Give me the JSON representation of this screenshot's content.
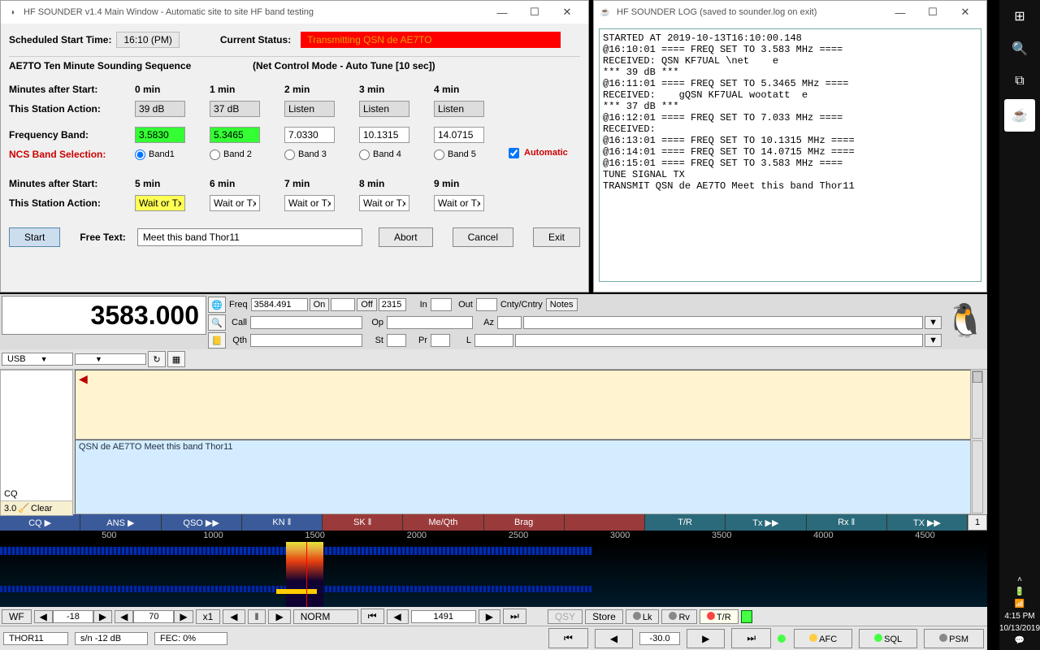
{
  "main_win": {
    "title": "HF SOUNDER v1.4 Main Window - Automatic site to site HF band testing",
    "sched_label": "Scheduled Start Time:",
    "sched_value": "16:10 (PM)",
    "status_label": "Current Status:",
    "status_value": "Transmitting QSN de AE7TO",
    "seq_title": "AE7TO  Ten Minute Sounding Sequence",
    "mode_title": "(Net Control Mode - Auto Tune [10 sec])",
    "row_labels": {
      "mins": "Minutes after Start:",
      "action": "This Station Action:",
      "freq": "Frequency Band:",
      "ncs": "NCS Band Selection:"
    },
    "cols1": [
      {
        "min": "0 min",
        "action": "39 dB",
        "action_cls": "ro",
        "freq": "3.5830",
        "freq_cls": "green",
        "band": "Band1",
        "checked": true
      },
      {
        "min": "1 min",
        "action": "37 dB",
        "action_cls": "ro",
        "freq": "5.3465",
        "freq_cls": "green",
        "band": "Band 2"
      },
      {
        "min": "2 min",
        "action": "Listen",
        "action_cls": "ro",
        "freq": "7.0330",
        "freq_cls": "",
        "band": "Band 3"
      },
      {
        "min": "3 min",
        "action": "Listen",
        "action_cls": "ro",
        "freq": "10.1315",
        "freq_cls": "",
        "band": "Band 4"
      },
      {
        "min": "4 min",
        "action": "Listen",
        "action_cls": "ro",
        "freq": "14.0715",
        "freq_cls": "",
        "band": "Band 5"
      }
    ],
    "auto_label": "Automatic",
    "cols2": [
      {
        "min": "5 min",
        "action": "Wait or Tx",
        "cls": "yellow"
      },
      {
        "min": "6 min",
        "action": "Wait or Tx"
      },
      {
        "min": "7 min",
        "action": "Wait or Tx"
      },
      {
        "min": "8 min",
        "action": "Wait or Tx"
      },
      {
        "min": "9 min",
        "action": "Wait or Tx"
      }
    ],
    "buttons": {
      "start": "Start",
      "abort": "Abort",
      "cancel": "Cancel",
      "exit": "Exit",
      "freetext_label": "Free Text:",
      "freetext_value": "Meet this band Thor11"
    }
  },
  "log_win": {
    "title": "HF SOUNDER LOG (saved to sounder.log on exit)",
    "text": "STARTED AT 2019-10-13T16:10:00.148\n@16:10:01 ==== FREQ SET TO 3.583 MHz ====\nRECEIVED: QSN KF7UAL \\net    e\n*** 39 dB ***\n@16:11:01 ==== FREQ SET TO 5.3465 MHz ====\nRECEIVED:    gQSN KF7UAL wootatt  e\n*** 37 dB ***\n@16:12:01 ==== FREQ SET TO 7.033 MHz ====\nRECEIVED:\n@16:13:01 ==== FREQ SET TO 10.1315 MHz ====\n@16:14:01 ==== FREQ SET TO 14.0715 MHz ====\n@16:15:01 ==== FREQ SET TO 3.583 MHz ====\nTUNE SIGNAL TX\nTRANSMIT QSN de AE7TO Meet this band Thor11"
  },
  "fldigi": {
    "bigfreq": "3583.000",
    "freq_label": "Freq",
    "freq_val": "3584.491",
    "on": "On",
    "off": "Off",
    "off_val": "2315",
    "in": "In",
    "out": "Out",
    "cc": "Cnty/Cntry",
    "notes": "Notes",
    "call": "Call",
    "op": "Op",
    "az": "Az",
    "qth": "Qth",
    "st": "St",
    "pr": "Pr",
    "l": "L",
    "mode": "USB",
    "tx_msg": "QSN de AE7TO Meet this band Thor11",
    "cq": "CQ",
    "clear": "Clear",
    "clear_num": "3.0",
    "macros": [
      "CQ ▶",
      "ANS ▶",
      "QSO ▶▶",
      "KN ‖",
      "SK ‖",
      "Me/Qth",
      "Brag",
      "",
      "T/R",
      "Tx ▶▶",
      "Rx ‖",
      "TX ▶▶"
    ],
    "macro_num": "1",
    "ruler": [
      "500",
      "1000",
      "1500",
      "2000",
      "2500",
      "3000",
      "3500",
      "4000",
      "4500"
    ],
    "ctrl": {
      "wf": "WF",
      "v1": "-18",
      "v2": "70",
      "zoom": "x1",
      "norm": "NORM",
      "cursor": "1491",
      "qsy": "QSY",
      "store": "Store",
      "lk": "Lk",
      "rv": "Rv",
      "tr": "T/R"
    },
    "status": {
      "mode": "THOR11",
      "sn": "s/n -12 dB",
      "fec": "FEC:    0%",
      "level": "-30.0",
      "afc": "AFC",
      "sql": "SQL",
      "psm": "PSM"
    }
  },
  "taskbar": {
    "time": "4:15 PM",
    "date": "10/13/2019"
  }
}
